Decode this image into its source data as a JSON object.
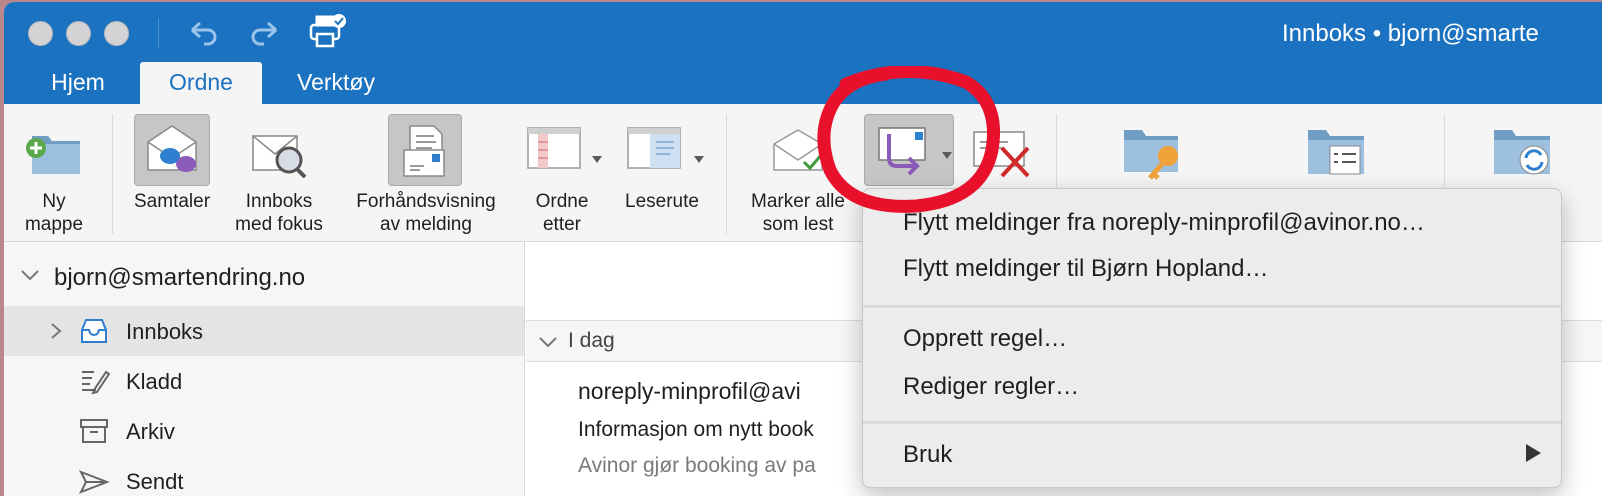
{
  "window": {
    "title": "Innboks • bjorn@smarte"
  },
  "toolbar": {
    "undo": "undo-icon",
    "redo": "redo-icon",
    "print": "print-icon"
  },
  "tabs": [
    {
      "label": "Hjem"
    },
    {
      "label": "Ordne",
      "active": true
    },
    {
      "label": "Verktøy"
    }
  ],
  "ribbon": {
    "new_folder": "Ny\nmappe",
    "conversations": "Samtaler",
    "focused_inbox": "Innboks\nmed fokus",
    "preview": "Forhåndsvisning\nav melding",
    "arrange_by": "Ordne\netter",
    "reading_pane": "Leserute",
    "mark_all_read": "Marker alle\nsom lest"
  },
  "sidebar": {
    "account": "bjorn@smartendring.no",
    "folders": [
      {
        "label": "Innboks",
        "selected": true
      },
      {
        "label": "Kladd"
      },
      {
        "label": "Arkiv"
      },
      {
        "label": "Sendt"
      }
    ]
  },
  "message_list": {
    "group_header": "I dag",
    "message": {
      "from": "noreply-minprofil@avi",
      "subject": "Informasjon om nytt book",
      "preview": "Avinor gjør booking av pa"
    }
  },
  "menu": {
    "items": [
      "Flytt meldinger fra noreply-minprofil@avinor.no…",
      "Flytt meldinger til Bjørn Hopland…",
      "Opprett regel…",
      "Rediger regler…",
      "Bruk"
    ]
  },
  "colors": {
    "accent": "#1b72c0",
    "annotation": "#e8102a"
  }
}
